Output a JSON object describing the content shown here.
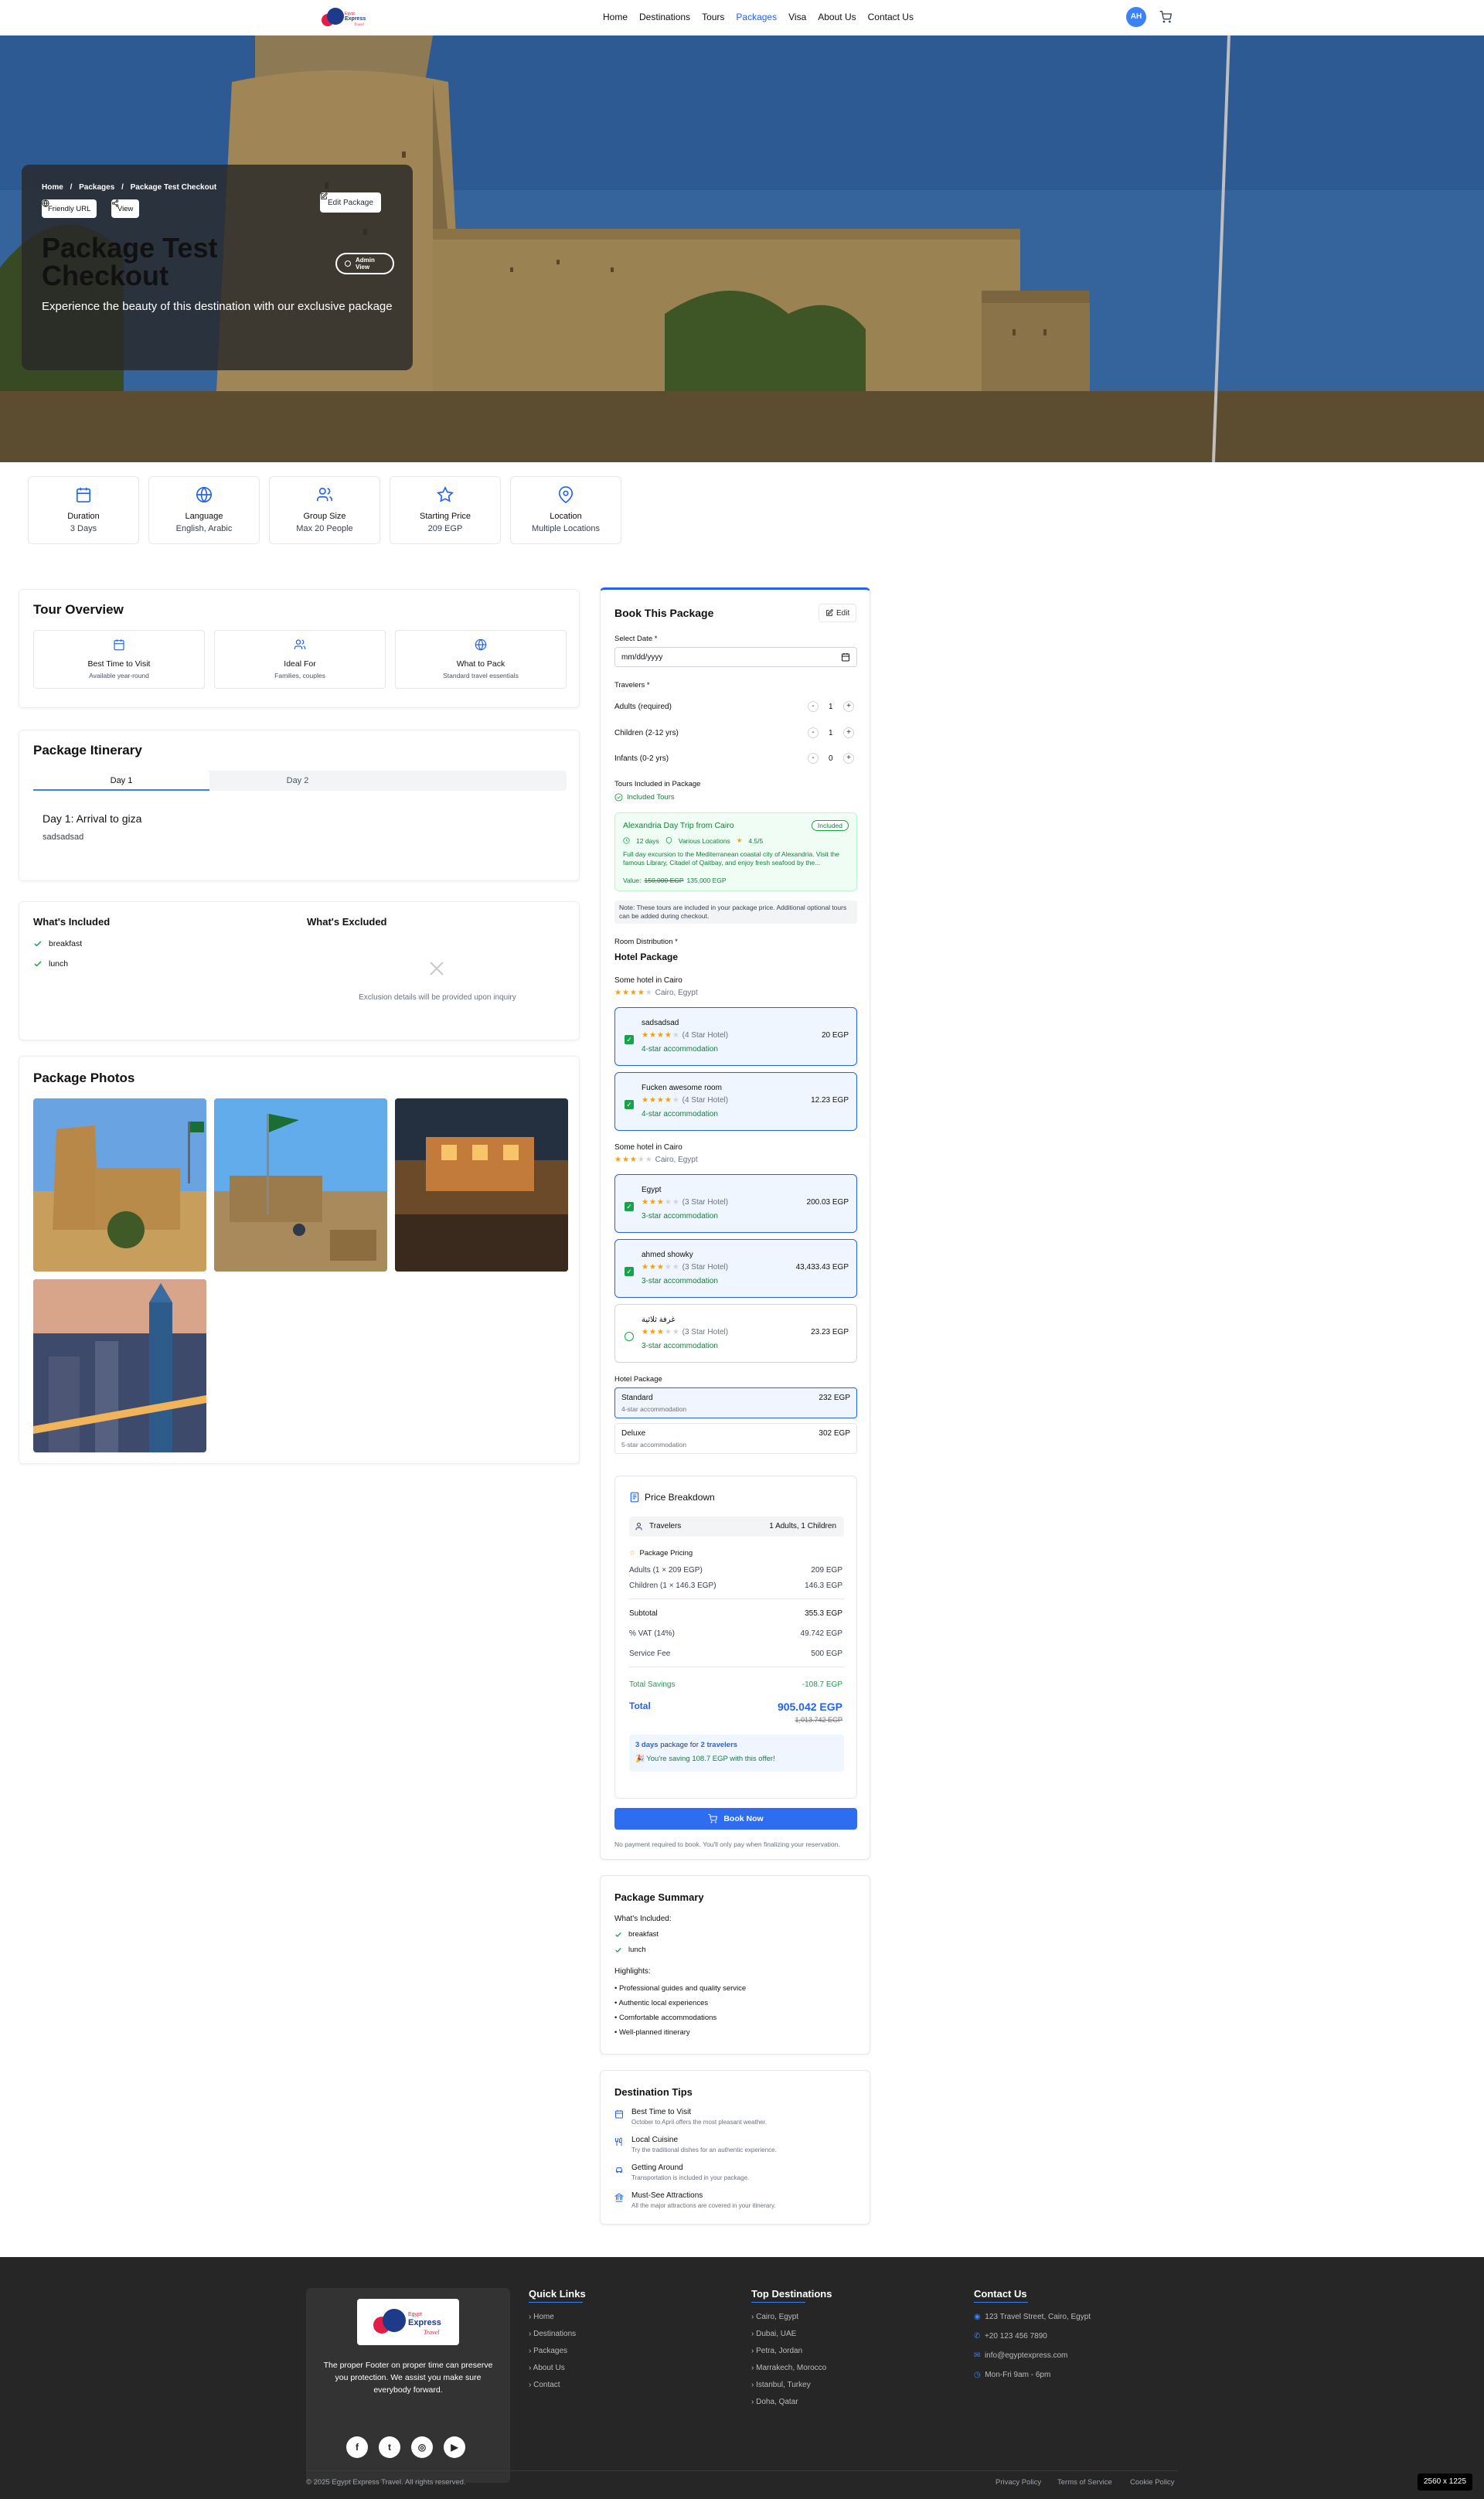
{
  "nav": {
    "items": [
      "Home",
      "Destinations",
      "Tours",
      "Packages",
      "Visa",
      "About Us",
      "Contact Us"
    ],
    "active": "Packages",
    "avatar_initials": "AH",
    "accent": "#2563eb"
  },
  "hero": {
    "breadcrumb": [
      "Home",
      "/",
      "Packages",
      "/",
      "Package Test Checkout"
    ],
    "friendly_url_label": "Friendly URL",
    "view_label": "View",
    "edit_label": "Edit Package",
    "title": "Package Test Checkout",
    "admin_view_label": "Admin View",
    "subtitle": "Experience the beauty of this destination with our exclusive package"
  },
  "stats": [
    {
      "icon": "calendar-icon",
      "label": "Duration",
      "value": "3 Days"
    },
    {
      "icon": "globe-icon",
      "label": "Language",
      "value": "English, Arabic"
    },
    {
      "icon": "users-icon",
      "label": "Group Size",
      "value": "Max 20 People"
    },
    {
      "icon": "star-icon",
      "label": "Starting Price",
      "value": "209 EGP"
    },
    {
      "icon": "map-pin-icon",
      "label": "Location",
      "value": "Multiple Locations"
    }
  ],
  "overview": {
    "title": "Tour Overview",
    "boxes": [
      {
        "icon": "calendar-icon",
        "title": "Best Time to Visit",
        "sub": "Available year-round"
      },
      {
        "icon": "users-icon",
        "title": "Ideal For",
        "sub": "Families, couples"
      },
      {
        "icon": "globe-icon",
        "title": "What to Pack",
        "sub": "Standard travel essentials"
      }
    ]
  },
  "itinerary": {
    "title": "Package Itinerary",
    "tabs": [
      "Day 1",
      "Day 2"
    ],
    "day_title": "Day 1: Arrival to giza",
    "day_text": "sadsadsad"
  },
  "inclusions": {
    "included_title": "What's Included",
    "included": [
      "breakfast",
      "lunch"
    ],
    "excluded_title": "What's Excluded",
    "excluded_note": "Exclusion details will be provided upon inquiry"
  },
  "photos": {
    "title": "Package Photos"
  },
  "booking": {
    "title": "Book This Package",
    "edit_label": "Edit",
    "date_label": "Select Date *",
    "date_placeholder": "mm/dd/yyyy",
    "travelers_label": "Travelers *",
    "travelers": [
      {
        "label": "Adults (required)",
        "count": "1"
      },
      {
        "label": "Children (2-12 yrs)",
        "count": "1"
      },
      {
        "label": "Infants (0-2 yrs)",
        "count": "0"
      }
    ],
    "tours_label": "Tours Included in Package",
    "included_tours_label": "Included Tours",
    "tour": {
      "name": "Alexandria Day Trip from Cairo",
      "badge": "Included",
      "duration": "12 days",
      "locations": "Various Locations",
      "rating": "4.5/5",
      "desc": "Full day excursion to the Mediterranean coastal city of Alexandria. Visit the famous Library, Citadel of Qaitbay, and enjoy fresh seafood by the...",
      "value_label": "Value:",
      "old_price": "150,000 EGP",
      "price": "135,000 EGP"
    },
    "note": "Note: These tours are included in your package price. Additional optional tours can be added during checkout.",
    "room_label": "Room Distribution *",
    "hotel_package_title": "Hotel Package",
    "hotel_groups": [
      {
        "name": "Some hotel in Cairo",
        "stars": 4,
        "location": "Cairo, Egypt",
        "rooms": [
          {
            "name": "sadsadsad",
            "star_text": "(4 Star Hotel)",
            "type": "4-star accommodation",
            "price": "20 EGP",
            "selected": true,
            "stars": 4
          },
          {
            "name": "Fucken awesome room",
            "star_text": "(4 Star Hotel)",
            "type": "4-star accommodation",
            "price": "12.23 EGP",
            "selected": true,
            "stars": 4
          }
        ]
      },
      {
        "name": "Some hotel in Cairo",
        "stars": 3,
        "location": "Cairo, Egypt",
        "rooms": [
          {
            "name": "Egypt",
            "star_text": "(3 Star Hotel)",
            "type": "3-star accommodation",
            "price": "200.03 EGP",
            "selected": true,
            "stars": 3
          },
          {
            "name": "ahmed showky",
            "star_text": "(3 Star Hotel)",
            "type": "3-star accommodation",
            "price": "43,433.43 EGP",
            "selected": true,
            "stars": 3
          },
          {
            "name": "غرفة ثلاثية",
            "star_text": "(3 Star Hotel)",
            "type": "3-star accommodation",
            "price": "23.23 EGP",
            "selected": false,
            "stars": 3
          }
        ]
      }
    ],
    "package_label": "Hotel Package",
    "packages": [
      {
        "name": "Standard",
        "sub": "4-star accommodation",
        "price": "232 EGP",
        "selected": true
      },
      {
        "name": "Deluxe",
        "sub": "5-star accommodation",
        "price": "302 EGP",
        "selected": false
      }
    ],
    "breakdown": {
      "title": "Price Breakdown",
      "travelers_label": "Travelers",
      "travelers_value": "1 Adults, 1 Children",
      "pricing_label": "Package Pricing",
      "rows": [
        {
          "label": "Adults (1 × 209 EGP)",
          "value": "209 EGP"
        },
        {
          "label": "Children (1 × 146.3 EGP)",
          "value": "146.3 EGP"
        }
      ],
      "subtotal_label": "Subtotal",
      "subtotal": "355.3 EGP",
      "vat_label": "% VAT (14%)",
      "vat": "49.742 EGP",
      "fee_label": "Service Fee",
      "fee": "500 EGP",
      "savings_label": "Total Savings",
      "savings": "-108.7 EGP",
      "total_label": "Total",
      "total": "905.042 EGP",
      "total_old": "1,013.742 EGP",
      "summary_days": "3 days",
      "summary_mid": "package for",
      "summary_travelers": "2 travelers",
      "saving_note": "🎉 You're saving 108.7 EGP with this offer!"
    },
    "book_now_label": "Book Now",
    "footnote": "No payment required to book. You'll only pay when finalizing your reservation."
  },
  "summary": {
    "title": "Package Summary",
    "included_label": "What's Included:",
    "included": [
      "breakfast",
      "lunch"
    ],
    "highlights_label": "Highlights:",
    "highlights": [
      "Professional guides and quality service",
      "Authentic local experiences",
      "Comfortable accommodations",
      "Well-planned itinerary"
    ]
  },
  "tips": {
    "title": "Destination Tips",
    "items": [
      {
        "icon": "calendar-icon",
        "title": "Best Time to Visit",
        "text": "October to April offers the most pleasant weather."
      },
      {
        "icon": "utensils-icon",
        "title": "Local Cuisine",
        "text": "Try the traditional dishes for an authentic experience."
      },
      {
        "icon": "car-icon",
        "title": "Getting Around",
        "text": "Transportation is included in your package."
      },
      {
        "icon": "landmark-icon",
        "title": "Must-See Attractions",
        "text": "All the major attractions are covered in your itinerary."
      }
    ]
  },
  "footer": {
    "tagline": "The proper Footer on proper time can preserve you protection. We assist you make sure everybody forward.",
    "quick_links_title": "Quick Links",
    "quick_links": [
      "Home",
      "Destinations",
      "Packages",
      "About Us",
      "Contact"
    ],
    "destinations_title": "Top Destinations",
    "destinations": [
      "Cairo, Egypt",
      "Dubai, UAE",
      "Petra, Jordan",
      "Marrakech, Morocco",
      "Istanbul, Turkey",
      "Doha, Qatar"
    ],
    "contact_title": "Contact Us",
    "contact": [
      {
        "icon": "map-pin-icon",
        "text": "123 Travel Street, Cairo, Egypt"
      },
      {
        "icon": "phone-icon",
        "text": "+20 123 456 7890"
      },
      {
        "icon": "mail-icon",
        "text": "info@egyptexpress.com"
      },
      {
        "icon": "clock-icon",
        "text": "Mon-Fri 9am - 6pm"
      }
    ],
    "copyright": "© 2025 Egypt Express Travel. All rights reserved.",
    "legal": [
      "Privacy Policy",
      "Terms of Service",
      "Cookie Policy"
    ],
    "logo_text_1": "Egypt",
    "logo_text_2": "Express",
    "logo_text_3": "Travel"
  },
  "resolution_badge": "2560 x 1225"
}
